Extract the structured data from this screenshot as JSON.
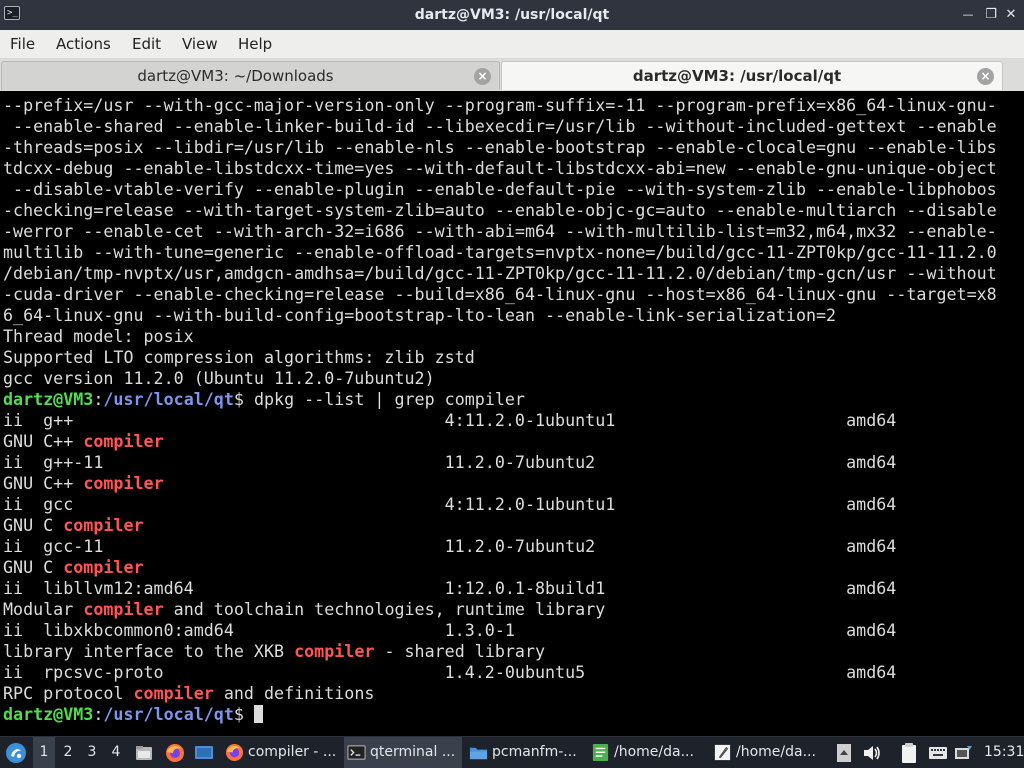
{
  "window": {
    "title": "dartz@VM3: /usr/local/qt",
    "app_icon_glyph": ">_",
    "minimize_glyph": "—",
    "maximize_glyph": "❐",
    "close_glyph": "✕"
  },
  "menu": {
    "items": [
      "File",
      "Actions",
      "Edit",
      "View",
      "Help"
    ]
  },
  "tabs": [
    {
      "label": "dartz@VM3: ~/Downloads",
      "active": false,
      "close_glyph": "×"
    },
    {
      "label": "dartz@VM3: /usr/local/qt",
      "active": true,
      "close_glyph": "×"
    }
  ],
  "terminal": {
    "lines": [
      [
        {
          "t": "--prefix=/usr --with-gcc-major-version-only --program-suffix=-11 --program-prefix=x86_64-linux-gnu-"
        }
      ],
      [
        {
          "t": " --enable-shared --enable-linker-build-id --libexecdir=/usr/lib --without-included-gettext --enable"
        }
      ],
      [
        {
          "t": "-threads=posix --libdir=/usr/lib --enable-nls --enable-bootstrap --enable-clocale=gnu --enable-libs"
        }
      ],
      [
        {
          "t": "tdcxx-debug --enable-libstdcxx-time=yes --with-default-libstdcxx-abi=new --enable-gnu-unique-object"
        }
      ],
      [
        {
          "t": " --disable-vtable-verify --enable-plugin --enable-default-pie --with-system-zlib --enable-libphobos"
        }
      ],
      [
        {
          "t": "-checking=release --with-target-system-zlib=auto --enable-objc-gc=auto --enable-multiarch --disable"
        }
      ],
      [
        {
          "t": "-werror --enable-cet --with-arch-32=i686 --with-abi=m64 --with-multilib-list=m32,m64,mx32 --enable-"
        }
      ],
      [
        {
          "t": "multilib --with-tune=generic --enable-offload-targets=nvptx-none=/build/gcc-11-ZPT0kp/gcc-11-11.2.0"
        }
      ],
      [
        {
          "t": "/debian/tmp-nvptx/usr,amdgcn-amdhsa=/build/gcc-11-ZPT0kp/gcc-11-11.2.0/debian/tmp-gcn/usr --without"
        }
      ],
      [
        {
          "t": "-cuda-driver --enable-checking=release --build=x86_64-linux-gnu --host=x86_64-linux-gnu --target=x8"
        }
      ],
      [
        {
          "t": "6_64-linux-gnu --with-build-config=bootstrap-lto-lean --enable-link-serialization=2"
        }
      ],
      [
        {
          "t": "Thread model: posix"
        }
      ],
      [
        {
          "t": "Supported LTO compression algorithms: zlib zstd"
        }
      ],
      [
        {
          "t": "gcc version 11.2.0 (Ubuntu 11.2.0-7ubuntu2)"
        }
      ],
      [
        {
          "t": "dartz@VM3",
          "c": "user"
        },
        {
          "t": ":"
        },
        {
          "t": "/usr/local/qt",
          "c": "path"
        },
        {
          "t": "$ dpkg --list | grep compiler"
        }
      ],
      [
        {
          "t": "ii  g++                                     4:11.2.0-1ubuntu1                       amd64"
        }
      ],
      [
        {
          "t": "GNU C++ "
        },
        {
          "t": "compiler",
          "c": "hl"
        }
      ],
      [
        {
          "t": "ii  g++-11                                  11.2.0-7ubuntu2                         amd64"
        }
      ],
      [
        {
          "t": "GNU C++ "
        },
        {
          "t": "compiler",
          "c": "hl"
        }
      ],
      [
        {
          "t": "ii  gcc                                     4:11.2.0-1ubuntu1                       amd64"
        }
      ],
      [
        {
          "t": "GNU C "
        },
        {
          "t": "compiler",
          "c": "hl"
        }
      ],
      [
        {
          "t": "ii  gcc-11                                  11.2.0-7ubuntu2                         amd64"
        }
      ],
      [
        {
          "t": "GNU C "
        },
        {
          "t": "compiler",
          "c": "hl"
        }
      ],
      [
        {
          "t": "ii  libllvm12:amd64                         1:12.0.1-8build1                        amd64"
        }
      ],
      [
        {
          "t": "Modular "
        },
        {
          "t": "compiler",
          "c": "hl"
        },
        {
          "t": " and toolchain technologies, runtime library"
        }
      ],
      [
        {
          "t": "ii  libxkbcommon0:amd64                     1.3.0-1                                 amd64"
        }
      ],
      [
        {
          "t": "library interface to the XKB "
        },
        {
          "t": "compiler",
          "c": "hl"
        },
        {
          "t": " - shared library"
        }
      ],
      [
        {
          "t": "ii  rpcsvc-proto                            1.4.2-0ubuntu5                          amd64"
        }
      ],
      [
        {
          "t": "RPC protocol "
        },
        {
          "t": "compiler",
          "c": "hl"
        },
        {
          "t": " and definitions"
        }
      ],
      [
        {
          "t": "dartz@VM3",
          "c": "user"
        },
        {
          "t": ":"
        },
        {
          "t": "/usr/local/qt",
          "c": "path"
        },
        {
          "t": "$ "
        },
        {
          "cursor": true
        }
      ]
    ]
  },
  "taskbar": {
    "workspaces": [
      "1",
      "2",
      "3",
      "4"
    ],
    "active_workspace": "1",
    "launchers": [
      {
        "name": "menu-icon"
      },
      {
        "name": "file-manager-launcher-icon"
      },
      {
        "name": "firefox-launcher-icon"
      },
      {
        "name": "desktop-icon"
      }
    ],
    "tasks": [
      {
        "label": "compiler - ...",
        "icon": "firefox-icon",
        "active": false
      },
      {
        "label": "qterminal ...",
        "icon": "terminal-icon",
        "active": true
      },
      {
        "label": "pcmanfm-...",
        "icon": "folder-icon",
        "active": false
      },
      {
        "label": "/home/da...",
        "icon": "text-editor-icon",
        "active": false
      },
      {
        "label": "/home/da...",
        "icon": "notepad-icon",
        "active": false
      }
    ],
    "clock": "15:31",
    "colors": {
      "firefox": "#ff7139",
      "folder": "#4a90d9",
      "editor": "#4caf50"
    }
  }
}
